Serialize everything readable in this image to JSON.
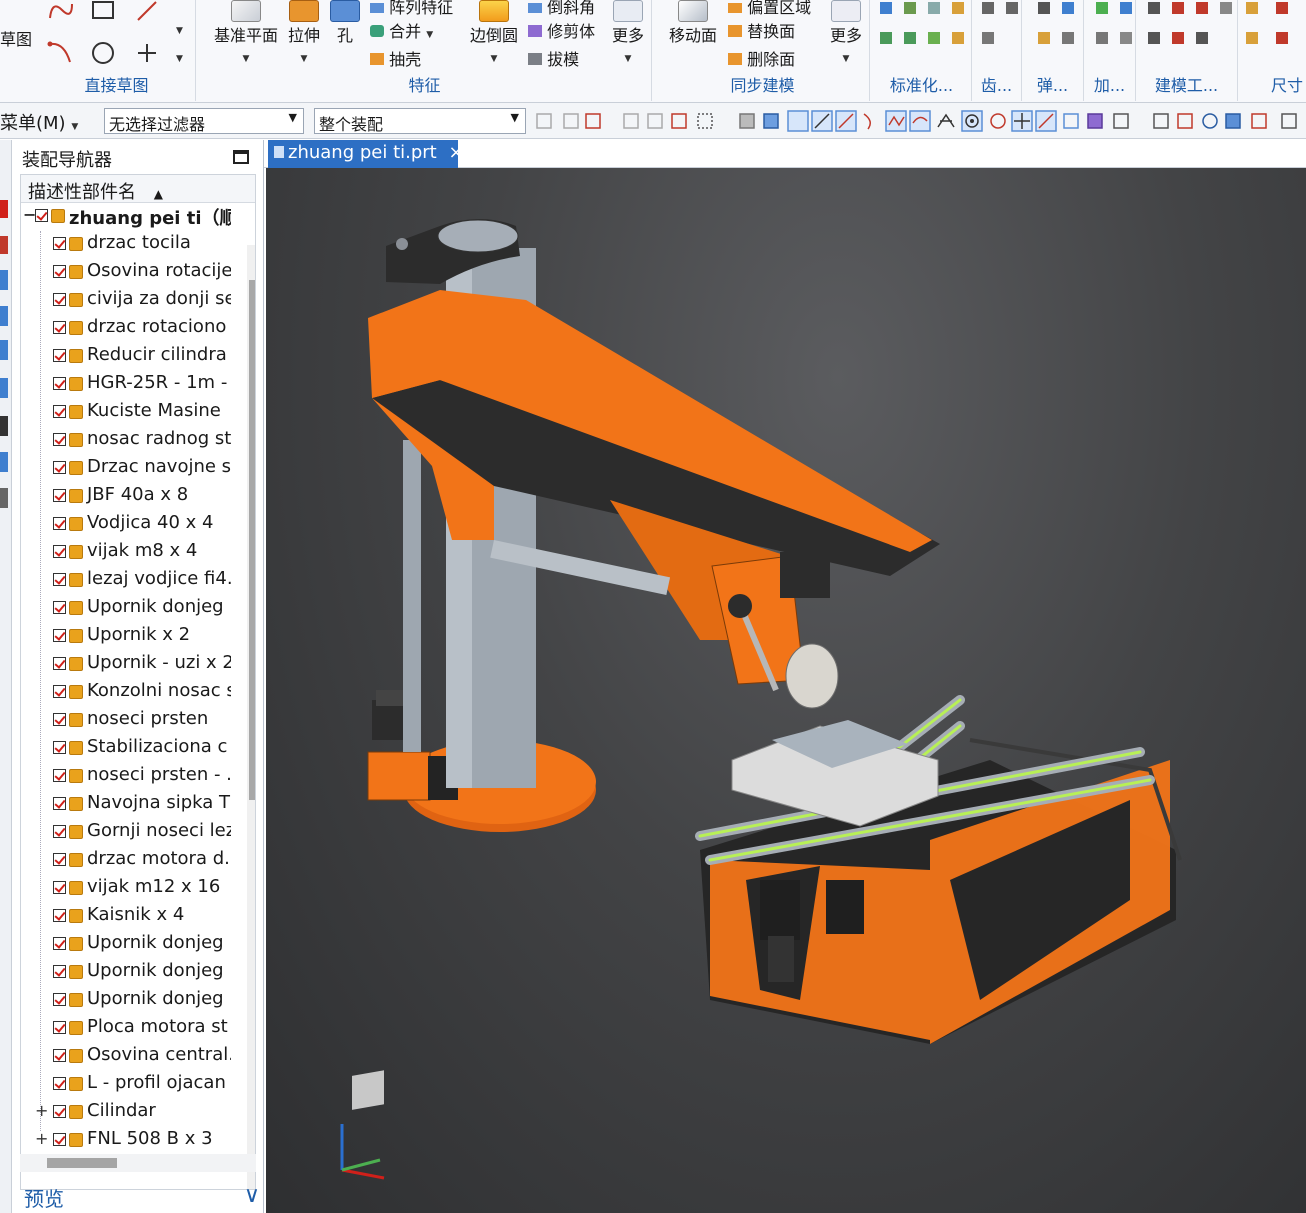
{
  "ribbon": {
    "group_direct_sketch": {
      "label": "直接草图",
      "partial_label": "草图"
    },
    "group_features": {
      "label": "特征",
      "datum_plane": "基准平面",
      "extrude": "拉伸",
      "hole": "孔",
      "pattern_feature": "阵列特征",
      "unite": "合并",
      "shell": "抽壳",
      "edge_blend": "边倒圆",
      "chamfer": "倒斜角",
      "trim_body": "修剪体",
      "draft": "拔模",
      "more": "更多"
    },
    "group_sync": {
      "label": "同步建模",
      "move_face": "移动面",
      "offset_region": "偏置区域",
      "replace_face": "替换面",
      "delete_face": "删除面",
      "more": "更多"
    },
    "groups_right": [
      "标准化...",
      "齿...",
      "弹...",
      "加...",
      "建模工...",
      "尺寸"
    ]
  },
  "toolbar2": {
    "menu": "菜单(M)",
    "filter": "无选择过滤器",
    "scope": "整个装配"
  },
  "navigator": {
    "title": "装配导航器",
    "column_header": "描述性部件名",
    "root": "zhuang pei ti（顺...",
    "items": [
      "drzac tocila",
      "Osovina rotacije",
      "civija za donji se",
      "drzac rotaciono",
      "Reducir cilindra",
      "HGR-25R - 1m -",
      "Kuciste Masine",
      "nosac radnog st",
      "Drzac navojne s",
      "JBF 40a x 8",
      "Vodjica 40 x 4",
      "vijak m8 x 4",
      "lezaj vodjice fi4.",
      "Upornik donjeg",
      "Upornik x 2",
      "Upornik - uzi x 2",
      "Konzolni nosac s",
      "noseci prsten",
      "Stabilizaciona c",
      "noseci prsten - ...",
      "Navojna sipka T",
      "Gornji noseci lez",
      "drzac motora d.",
      "vijak m12 x 16",
      "Kaisnik x 4",
      "Upornik donjeg",
      "Upornik donjeg",
      "Upornik donjeg",
      "Ploca motora st",
      "Osovina central.",
      "L - profil ojacan",
      "Cilindar",
      "FNL 508 B x 3"
    ],
    "preview": "预览"
  },
  "tab": {
    "filename": "zhuang pei ti.prt",
    "close": "×"
  },
  "colors": {
    "accent_blue": "#2d6fc4",
    "model_orange": "#f27418",
    "model_dark": "#2c2c2c",
    "model_steel": "#9ea7b0"
  }
}
